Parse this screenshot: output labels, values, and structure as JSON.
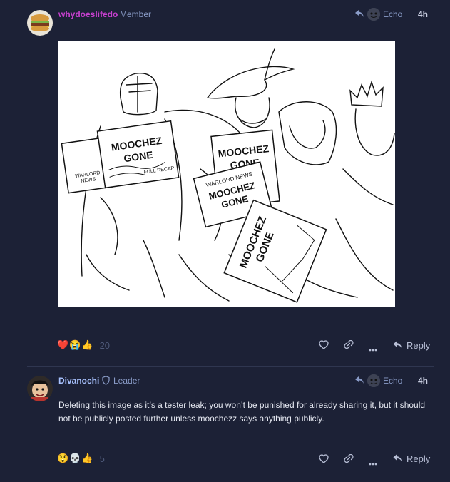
{
  "post1": {
    "username": "whydoeslifedo",
    "title": "Member",
    "reply_to": "Echo",
    "time": "4h",
    "image_texts": {
      "paper1": "MOOCHEZ GONE",
      "paper1_side": "WARLORD NEWS",
      "paper1_small": "FULL RECAP",
      "paper2": "MOOCHEZ GONE",
      "paper3_header": "WARLORD NEWS",
      "paper3": "MOOCHEZ GONE",
      "paper4": "MOOCHEZ GONE"
    },
    "reactions": [
      "❤️",
      "😭",
      "👍"
    ],
    "reaction_count": "20",
    "reply_label": "Reply"
  },
  "post2": {
    "username": "Divanochi",
    "title": "Leader",
    "reply_to": "Echo",
    "time": "4h",
    "body": "Deleting this image as it’s a tester leak; you won’t be punished for already sharing it, but it should not be publicly posted further unless moochezz says anything publicly.",
    "reactions": [
      "😲",
      "💀",
      "👍"
    ],
    "reaction_count": "5",
    "reply_label": "Reply"
  },
  "colors": {
    "background": "#1c2136",
    "username1": "#c740cf",
    "username2": "#a8c2ff",
    "muted": "#8a9cc8"
  }
}
